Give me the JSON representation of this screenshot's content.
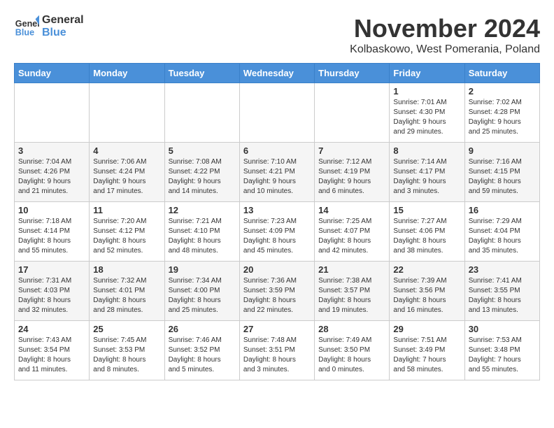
{
  "logo": {
    "line1": "General",
    "line2": "Blue"
  },
  "title": "November 2024",
  "location": "Kolbaskowo, West Pomerania, Poland",
  "days_header": [
    "Sunday",
    "Monday",
    "Tuesday",
    "Wednesday",
    "Thursday",
    "Friday",
    "Saturday"
  ],
  "weeks": [
    [
      {
        "day": "",
        "info": ""
      },
      {
        "day": "",
        "info": ""
      },
      {
        "day": "",
        "info": ""
      },
      {
        "day": "",
        "info": ""
      },
      {
        "day": "",
        "info": ""
      },
      {
        "day": "1",
        "info": "Sunrise: 7:01 AM\nSunset: 4:30 PM\nDaylight: 9 hours\nand 29 minutes."
      },
      {
        "day": "2",
        "info": "Sunrise: 7:02 AM\nSunset: 4:28 PM\nDaylight: 9 hours\nand 25 minutes."
      }
    ],
    [
      {
        "day": "3",
        "info": "Sunrise: 7:04 AM\nSunset: 4:26 PM\nDaylight: 9 hours\nand 21 minutes."
      },
      {
        "day": "4",
        "info": "Sunrise: 7:06 AM\nSunset: 4:24 PM\nDaylight: 9 hours\nand 17 minutes."
      },
      {
        "day": "5",
        "info": "Sunrise: 7:08 AM\nSunset: 4:22 PM\nDaylight: 9 hours\nand 14 minutes."
      },
      {
        "day": "6",
        "info": "Sunrise: 7:10 AM\nSunset: 4:21 PM\nDaylight: 9 hours\nand 10 minutes."
      },
      {
        "day": "7",
        "info": "Sunrise: 7:12 AM\nSunset: 4:19 PM\nDaylight: 9 hours\nand 6 minutes."
      },
      {
        "day": "8",
        "info": "Sunrise: 7:14 AM\nSunset: 4:17 PM\nDaylight: 9 hours\nand 3 minutes."
      },
      {
        "day": "9",
        "info": "Sunrise: 7:16 AM\nSunset: 4:15 PM\nDaylight: 8 hours\nand 59 minutes."
      }
    ],
    [
      {
        "day": "10",
        "info": "Sunrise: 7:18 AM\nSunset: 4:14 PM\nDaylight: 8 hours\nand 55 minutes."
      },
      {
        "day": "11",
        "info": "Sunrise: 7:20 AM\nSunset: 4:12 PM\nDaylight: 8 hours\nand 52 minutes."
      },
      {
        "day": "12",
        "info": "Sunrise: 7:21 AM\nSunset: 4:10 PM\nDaylight: 8 hours\nand 48 minutes."
      },
      {
        "day": "13",
        "info": "Sunrise: 7:23 AM\nSunset: 4:09 PM\nDaylight: 8 hours\nand 45 minutes."
      },
      {
        "day": "14",
        "info": "Sunrise: 7:25 AM\nSunset: 4:07 PM\nDaylight: 8 hours\nand 42 minutes."
      },
      {
        "day": "15",
        "info": "Sunrise: 7:27 AM\nSunset: 4:06 PM\nDaylight: 8 hours\nand 38 minutes."
      },
      {
        "day": "16",
        "info": "Sunrise: 7:29 AM\nSunset: 4:04 PM\nDaylight: 8 hours\nand 35 minutes."
      }
    ],
    [
      {
        "day": "17",
        "info": "Sunrise: 7:31 AM\nSunset: 4:03 PM\nDaylight: 8 hours\nand 32 minutes."
      },
      {
        "day": "18",
        "info": "Sunrise: 7:32 AM\nSunset: 4:01 PM\nDaylight: 8 hours\nand 28 minutes."
      },
      {
        "day": "19",
        "info": "Sunrise: 7:34 AM\nSunset: 4:00 PM\nDaylight: 8 hours\nand 25 minutes."
      },
      {
        "day": "20",
        "info": "Sunrise: 7:36 AM\nSunset: 3:59 PM\nDaylight: 8 hours\nand 22 minutes."
      },
      {
        "day": "21",
        "info": "Sunrise: 7:38 AM\nSunset: 3:57 PM\nDaylight: 8 hours\nand 19 minutes."
      },
      {
        "day": "22",
        "info": "Sunrise: 7:39 AM\nSunset: 3:56 PM\nDaylight: 8 hours\nand 16 minutes."
      },
      {
        "day": "23",
        "info": "Sunrise: 7:41 AM\nSunset: 3:55 PM\nDaylight: 8 hours\nand 13 minutes."
      }
    ],
    [
      {
        "day": "24",
        "info": "Sunrise: 7:43 AM\nSunset: 3:54 PM\nDaylight: 8 hours\nand 11 minutes."
      },
      {
        "day": "25",
        "info": "Sunrise: 7:45 AM\nSunset: 3:53 PM\nDaylight: 8 hours\nand 8 minutes."
      },
      {
        "day": "26",
        "info": "Sunrise: 7:46 AM\nSunset: 3:52 PM\nDaylight: 8 hours\nand 5 minutes."
      },
      {
        "day": "27",
        "info": "Sunrise: 7:48 AM\nSunset: 3:51 PM\nDaylight: 8 hours\nand 3 minutes."
      },
      {
        "day": "28",
        "info": "Sunrise: 7:49 AM\nSunset: 3:50 PM\nDaylight: 8 hours\nand 0 minutes."
      },
      {
        "day": "29",
        "info": "Sunrise: 7:51 AM\nSunset: 3:49 PM\nDaylight: 7 hours\nand 58 minutes."
      },
      {
        "day": "30",
        "info": "Sunrise: 7:53 AM\nSunset: 3:48 PM\nDaylight: 7 hours\nand 55 minutes."
      }
    ]
  ]
}
